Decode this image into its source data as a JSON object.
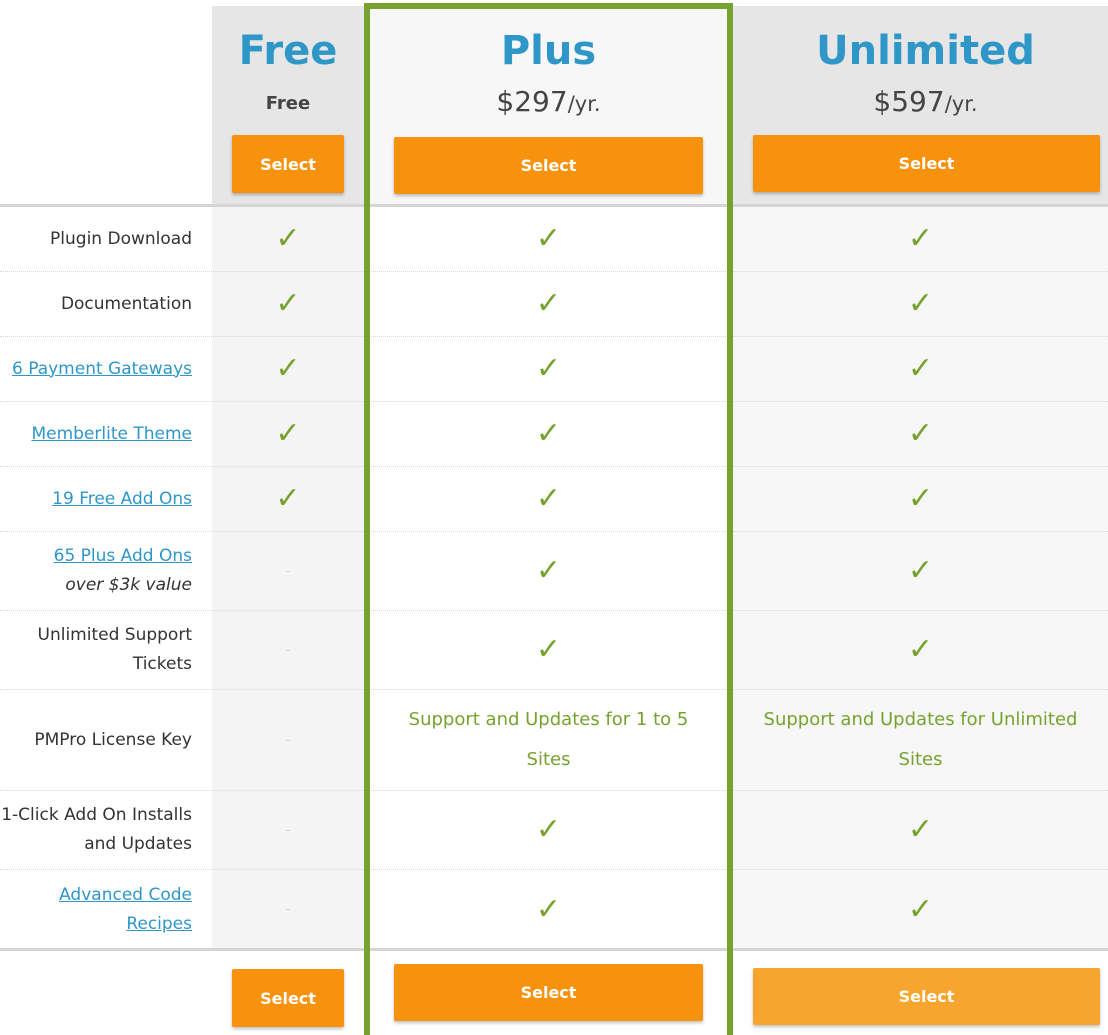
{
  "plans": [
    {
      "id": "free",
      "name": "Free",
      "price": "Free",
      "price_suffix": "",
      "select_label": "Select"
    },
    {
      "id": "plus",
      "name": "Plus",
      "price": "$297",
      "price_suffix": "/yr.",
      "select_label": "Select",
      "highlighted": true
    },
    {
      "id": "unlimited",
      "name": "Unlimited",
      "price": "$597",
      "price_suffix": "/yr.",
      "select_label": "Select"
    }
  ],
  "features": [
    {
      "label": "Plugin Download",
      "link": false,
      "values": [
        "check",
        "check",
        "check"
      ]
    },
    {
      "label": "Documentation",
      "link": false,
      "values": [
        "check",
        "check",
        "check"
      ]
    },
    {
      "label": "6 Payment Gateways",
      "link": true,
      "values": [
        "check",
        "check",
        "check"
      ]
    },
    {
      "label": "Memberlite Theme",
      "link": true,
      "values": [
        "check",
        "check",
        "check"
      ]
    },
    {
      "label": "19 Free Add Ons",
      "link": true,
      "values": [
        "check",
        "check",
        "check"
      ]
    },
    {
      "label": "65 Plus Add Ons",
      "note": "over $3k value",
      "link": true,
      "values": [
        "-",
        "check",
        "check"
      ]
    },
    {
      "label": "Unlimited Support Tickets",
      "link": false,
      "values": [
        "-",
        "check",
        "check"
      ]
    },
    {
      "label": "PMPro License Key",
      "link": false,
      "values": [
        "-",
        "Support and Updates for 1 to 5 Sites",
        "Support and Updates for Unlimited Sites"
      ]
    },
    {
      "label": "1-Click Add On Installs and Updates",
      "link": false,
      "values": [
        "-",
        "check",
        "check"
      ]
    },
    {
      "label": "Advanced Code Recipes",
      "link": true,
      "values": [
        "-",
        "check",
        "check"
      ]
    }
  ],
  "icons": {
    "check": "✓",
    "dash": "-"
  },
  "colors": {
    "accent_blue": "#2e97c7",
    "highlight_green": "#77a22f",
    "button_orange": "#f7920f"
  }
}
